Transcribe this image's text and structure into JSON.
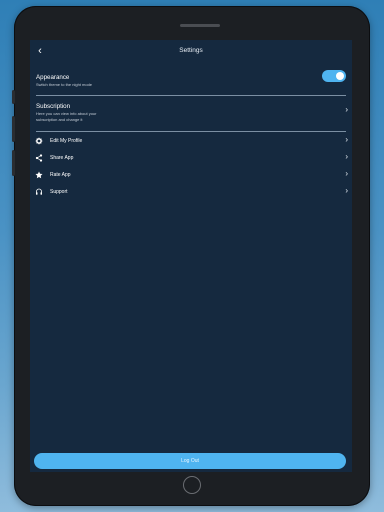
{
  "header": {
    "title": "Settings",
    "back_icon": "chevron-left-icon"
  },
  "appearance": {
    "title": "Appearance",
    "subtitle": "Switch theme to the night mode",
    "dark_mode_enabled": true
  },
  "subscription": {
    "title": "Subscription",
    "subtitle_line1": "Here you can view info about your",
    "subtitle_line2": "subscription and change it"
  },
  "menu": {
    "items": [
      {
        "label": "Edit My Profile",
        "icon": "gear-icon"
      },
      {
        "label": "Share App",
        "icon": "share-icon"
      },
      {
        "label": "Rate App",
        "icon": "star-icon"
      },
      {
        "label": "Support",
        "icon": "headset-icon"
      }
    ]
  },
  "footer": {
    "logout_label": "Log Out"
  },
  "colors": {
    "screen_bg": "#15293f",
    "accent": "#4fb4f0",
    "text": "#ffffff"
  }
}
